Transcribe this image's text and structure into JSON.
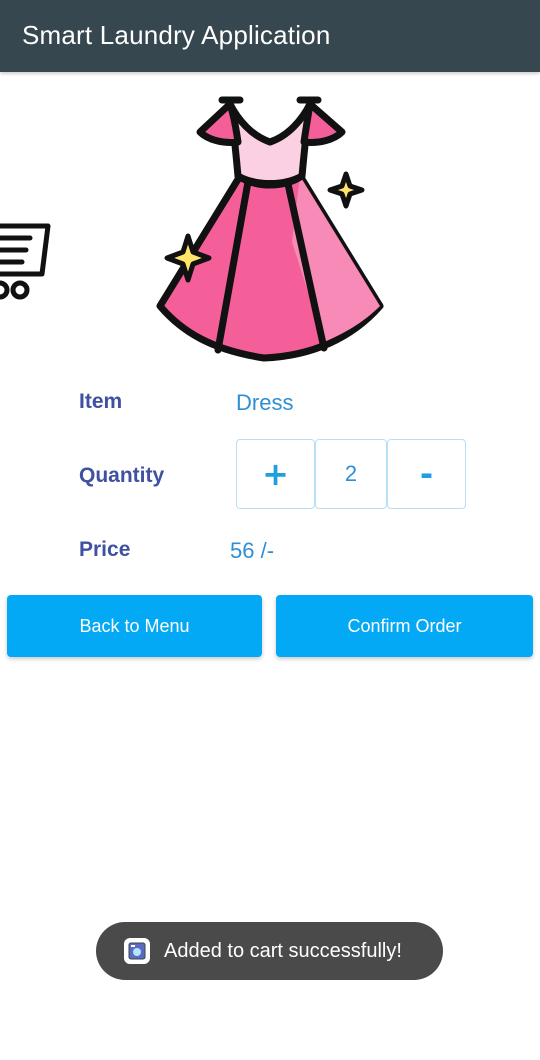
{
  "app": {
    "title": "Smart Laundry Application"
  },
  "icons": {
    "cart": "shopping-cart-icon",
    "item_image": "dress-icon",
    "toast_app": "app-icon"
  },
  "colors": {
    "appbar": "#37474f",
    "label": "#3f51a0",
    "value": "#2f8fd3",
    "button": "#03a9f4",
    "dress_pink": "#f45f9a",
    "dress_light": "#fbd0e3",
    "sparkle": "#ffe66b"
  },
  "item": {
    "label": "Item",
    "value": "Dress"
  },
  "quantity": {
    "label": "Quantity",
    "increment_symbol": "+",
    "value": "2",
    "decrement_symbol": "-"
  },
  "price": {
    "label": "Price",
    "value": "56 /-"
  },
  "buttons": {
    "back": "Back to Menu",
    "confirm": "Confirm Order"
  },
  "toast": {
    "message": "Added to cart successfully!"
  }
}
